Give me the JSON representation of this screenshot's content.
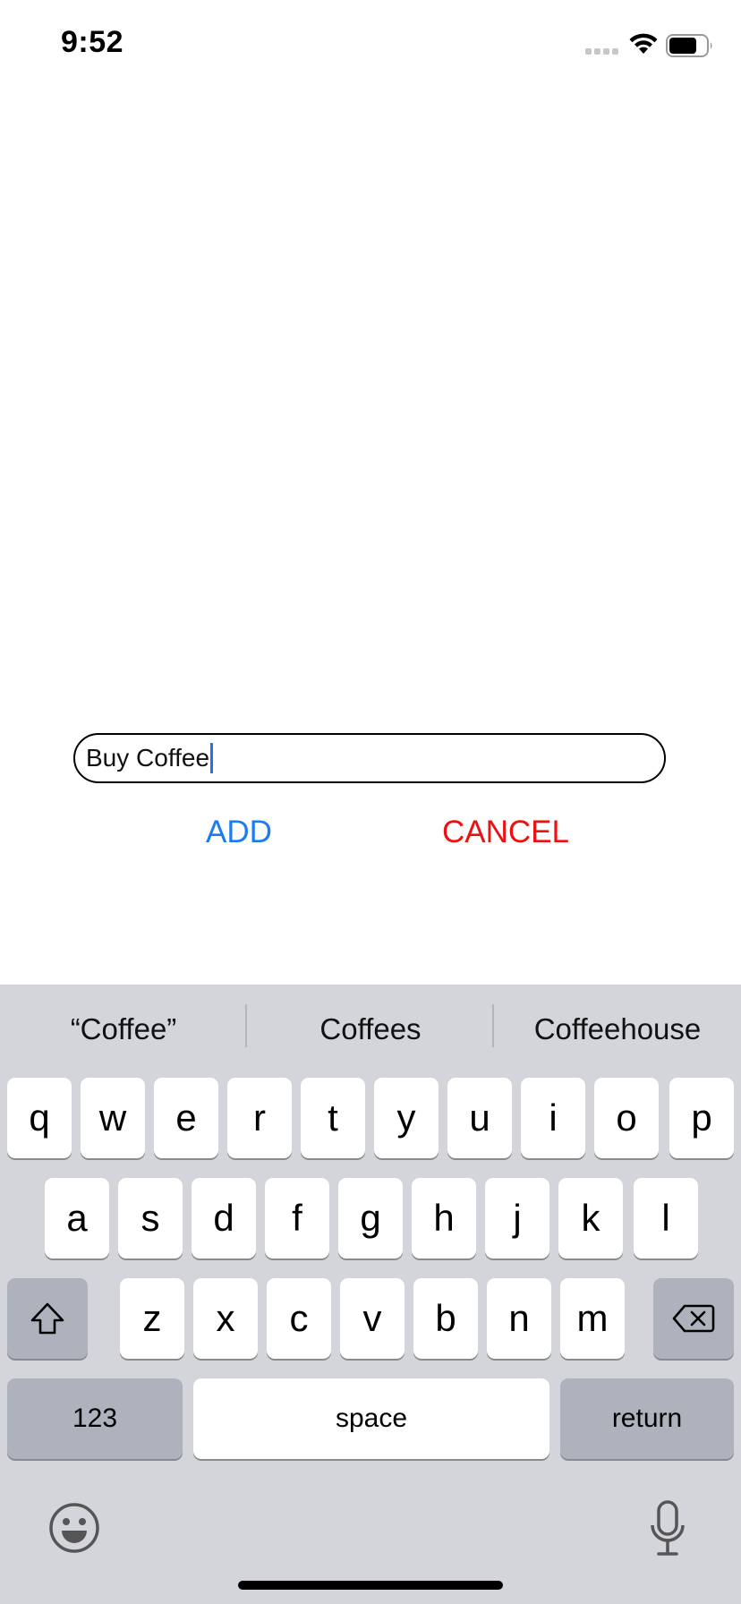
{
  "status_bar": {
    "time": "9:52"
  },
  "form": {
    "input_value": "Buy Coffee",
    "add_label": "ADD",
    "cancel_label": "CANCEL",
    "add_color": "#1a7cf0",
    "cancel_color": "#ee1111"
  },
  "keyboard": {
    "suggestions": [
      "“Coffee”",
      "Coffees",
      "Coffeehouse"
    ],
    "row1": [
      "q",
      "w",
      "e",
      "r",
      "t",
      "y",
      "u",
      "i",
      "o",
      "p"
    ],
    "row2": [
      "a",
      "s",
      "d",
      "f",
      "g",
      "h",
      "j",
      "k",
      "l"
    ],
    "row3": [
      "z",
      "x",
      "c",
      "v",
      "b",
      "n",
      "m"
    ],
    "numbers_label": "123",
    "space_label": "space",
    "return_label": "return",
    "icons": {
      "shift": "shift-icon",
      "backspace": "backspace-icon",
      "emoji": "emoji-icon",
      "dictation": "microphone-icon"
    }
  }
}
